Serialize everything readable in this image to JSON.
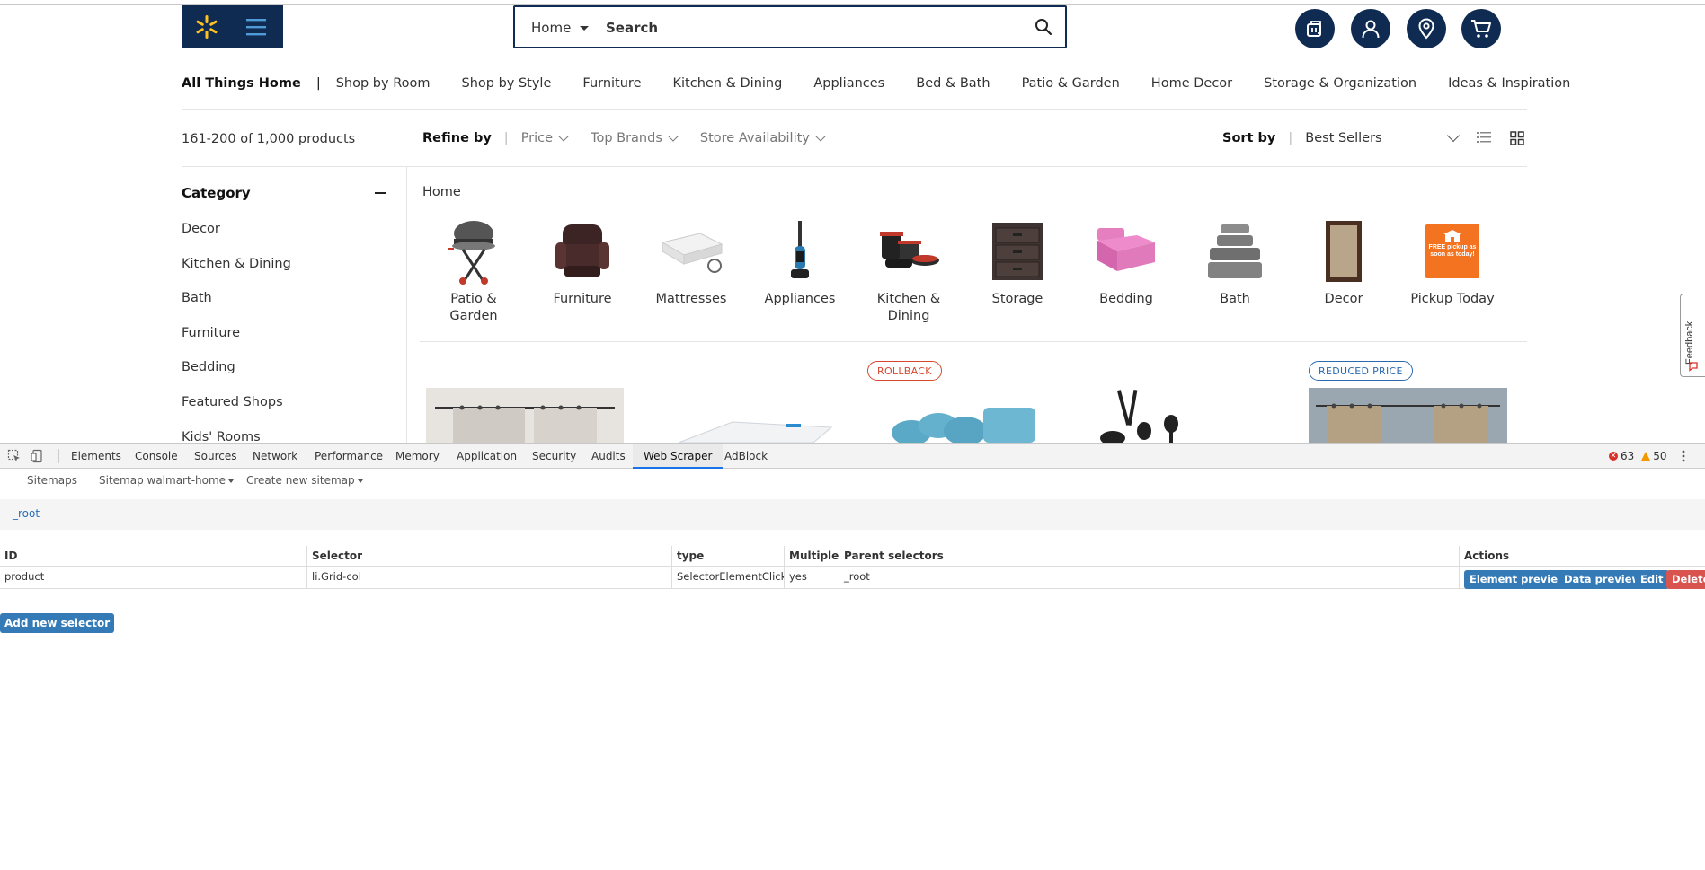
{
  "site": {
    "search": {
      "department": "Home",
      "placeholder": "Search"
    },
    "subnav": {
      "title": "All Things Home",
      "items": [
        "Shop by Room",
        "Shop by Style",
        "Furniture",
        "Kitchen & Dining",
        "Appliances",
        "Bed & Bath",
        "Patio & Garden",
        "Home Decor",
        "Storage & Organization",
        "Ideas & Inspiration"
      ]
    },
    "results": {
      "count": "161-200 of 1,000 products",
      "refine_label": "Refine by",
      "filters": [
        "Price",
        "Top Brands",
        "Store Availability"
      ],
      "sort_label": "Sort by",
      "sort_value": "Best Sellers"
    },
    "category": {
      "heading": "Category",
      "items": [
        "Decor",
        "Kitchen & Dining",
        "Bath",
        "Furniture",
        "Bedding",
        "Featured Shops",
        "Kids' Rooms"
      ]
    },
    "breadcrumb": "Home",
    "tiles": [
      {
        "label1": "Patio &",
        "label2": "Garden",
        "icon": "grill-icon"
      },
      {
        "label1": "Furniture",
        "label2": "",
        "icon": "recliner-icon"
      },
      {
        "label1": "Mattresses",
        "label2": "",
        "icon": "mattress-icon"
      },
      {
        "label1": "Appliances",
        "label2": "",
        "icon": "vacuum-icon"
      },
      {
        "label1": "Kitchen &",
        "label2": "Dining",
        "icon": "cookware-icon"
      },
      {
        "label1": "Storage",
        "label2": "",
        "icon": "drawers-icon"
      },
      {
        "label1": "Bedding",
        "label2": "",
        "icon": "bedding-icon"
      },
      {
        "label1": "Bath",
        "label2": "",
        "icon": "towels-icon"
      },
      {
        "label1": "Decor",
        "label2": "",
        "icon": "rug-icon"
      },
      {
        "label1": "Pickup Today",
        "label2": "",
        "icon": "pickup-icon",
        "badge_text": "FREE pickup as soon as today!"
      }
    ],
    "badges": {
      "rollback": "ROLLBACK",
      "reduced": "REDUCED PRICE"
    },
    "feedback": "Feedback",
    "colors": {
      "navy": "#0f2b52",
      "spark": "#ffc220",
      "pickup": "#f47321"
    }
  },
  "devtools": {
    "tabs": [
      "Elements",
      "Console",
      "Sources",
      "Network",
      "Performance",
      "Memory",
      "Application",
      "Security",
      "Audits",
      "Web Scraper",
      "AdBlock"
    ],
    "active_tab": "Web Scraper",
    "errors": "63",
    "warnings": "50",
    "scraper_nav": {
      "sitemaps": "Sitemaps",
      "sitemap": "Sitemap walmart-home",
      "create": "Create new sitemap"
    },
    "breadcrumb": "_root",
    "table": {
      "headers": [
        "ID",
        "Selector",
        "type",
        "Multiple",
        "Parent selectors",
        "Actions"
      ],
      "rows": [
        {
          "id": "product",
          "selector": "li.Grid-col",
          "type": "SelectorElementClick",
          "multiple": "yes",
          "parent": "_root"
        }
      ],
      "actions": [
        "Element preview",
        "Data preview",
        "Edit",
        "Delete"
      ]
    },
    "add_button": "Add new selector"
  }
}
